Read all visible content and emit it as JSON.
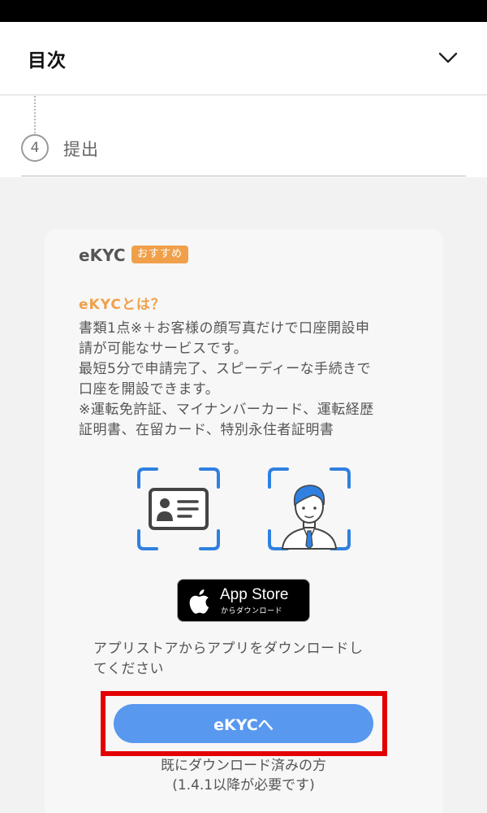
{
  "header": {
    "title": "目次",
    "toggle_icon": "chevron-down-icon"
  },
  "step": {
    "number": "4",
    "label": "提出"
  },
  "card": {
    "heading": "eKYC",
    "badge": "おすすめ",
    "subheading": "eKYCとは？",
    "description_lines": [
      "書類1点※＋お客様の顔写真だけで口座開設申",
      "請が可能なサービスです。",
      "最短5分で申請完了、スピーディーな手続きで",
      "口座を開設できます。",
      "※運転免許証、マイナンバーカード、運転経歴",
      "証明書、在留カード、特別永住者証明書"
    ],
    "illustrations": [
      "id-card-icon",
      "person-face-icon"
    ],
    "app_store": {
      "main": "App Store",
      "sub": "からダウンロード",
      "icon": "apple-icon"
    },
    "app_store_note_lines": [
      "アプリストアからアプリをダウンロードし",
      "てください"
    ],
    "button_label": "eKYCへ",
    "footer_lines": [
      "既にダウンロード済みの方",
      "(1.4.1以降が必要です)"
    ]
  },
  "colors": {
    "accent_orange": "#f0a04b",
    "button_blue": "#5898ef",
    "highlight_red": "#e30000",
    "frame_blue": "#2f80e0"
  }
}
